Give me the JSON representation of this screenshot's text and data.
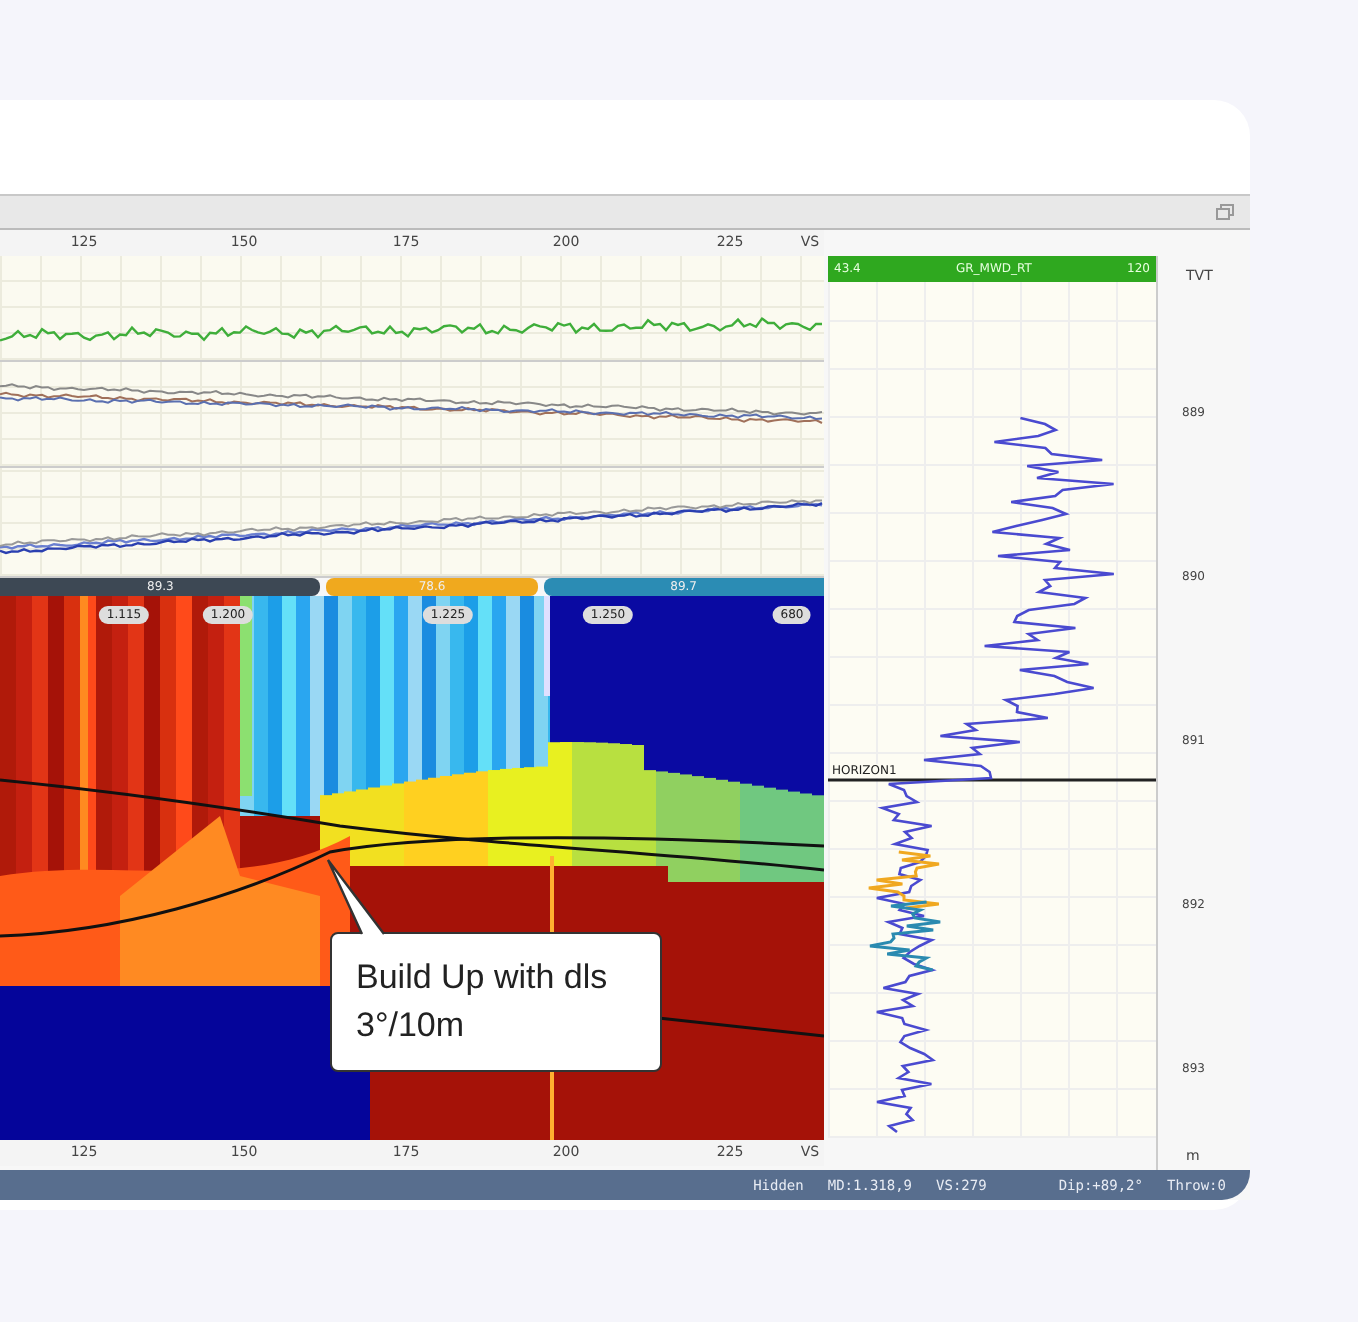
{
  "top_axis": {
    "ticks": [
      "125",
      "150",
      "175",
      "200",
      "225",
      "VS"
    ]
  },
  "segments": [
    {
      "label": "89.3",
      "color": "#3d4854"
    },
    {
      "label": "78.6",
      "color": "#f0a91e"
    },
    {
      "label": "89.7",
      "color": "#2b8cb4"
    }
  ],
  "section": {
    "markers": [
      "1.115",
      "1.200",
      "1.225",
      "1.250",
      "680"
    ],
    "callout": "Build Up with dls 3°/10m"
  },
  "bottom_axis": {
    "ticks": [
      "125",
      "150",
      "175",
      "200",
      "225",
      "VS"
    ]
  },
  "gr_track": {
    "min": "43.4",
    "name": "GR_MWD_RT",
    "max": "120",
    "horizon": "HORIZON1"
  },
  "depth_scale": {
    "unit_top": "TVT",
    "labels": [
      "889",
      "890",
      "891",
      "892",
      "893"
    ],
    "unit_bottom": "m"
  },
  "status_bar": {
    "items": [
      "Hidden",
      "MD:1.318,9",
      "VS:279",
      "Dip:+89,2°",
      "Throw:0"
    ]
  }
}
